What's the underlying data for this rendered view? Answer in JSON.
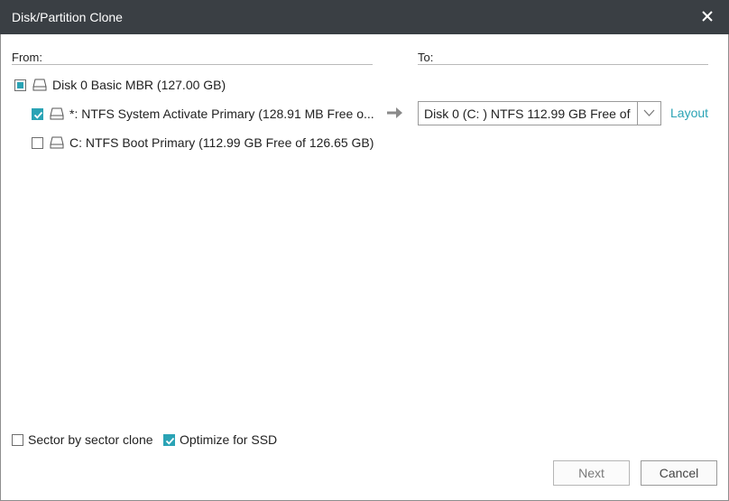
{
  "window": {
    "title": "Disk/Partition Clone"
  },
  "from": {
    "label": "From:",
    "disk": {
      "label": "Disk 0 Basic MBR (127.00 GB)",
      "state": "partial"
    },
    "partitions": [
      {
        "label": "*: NTFS System Activate Primary  (128.91 MB Free o...",
        "checked": true
      },
      {
        "label": "C: NTFS Boot Primary  (112.99 GB Free of 126.65 GB)",
        "checked": false
      }
    ]
  },
  "to": {
    "label": "To:",
    "target_value": "Disk 0 (C: ) NTFS 112.99 GB Free of",
    "layout_link": "Layout"
  },
  "options": {
    "sector_by_sector": {
      "label": "Sector by sector clone",
      "checked": false
    },
    "optimize_ssd": {
      "label": "Optimize for SSD",
      "checked": true
    }
  },
  "buttons": {
    "next": "Next",
    "cancel": "Cancel"
  },
  "colors": {
    "titlebar": "#3a3f44",
    "accent": "#2aa3b5"
  },
  "icons": {
    "close": "close-icon",
    "disk": "disk-icon",
    "arrow": "arrow-right-icon",
    "dropdown": "chevron-down-icon"
  }
}
